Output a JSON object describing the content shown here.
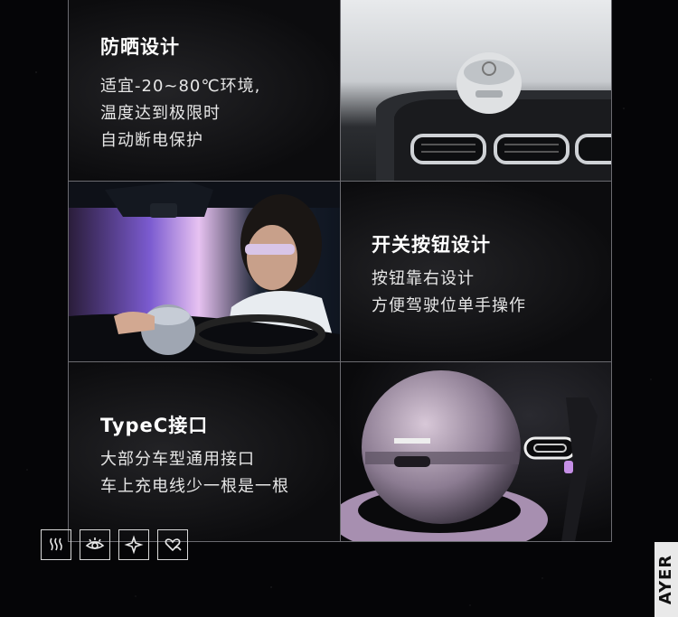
{
  "features": [
    {
      "title": "防晒设计",
      "lines": [
        "适宜-20~80℃环境,",
        "温度达到极限时",
        "自动断电保护"
      ]
    },
    {
      "title": "开关按钮设计",
      "lines": [
        "按钮靠右设计",
        "方便驾驶位单手操作"
      ]
    },
    {
      "title": "TypeC接口",
      "lines": [
        "大部分车型通用接口",
        "车上充电线少一根是一根"
      ]
    }
  ],
  "icons": [
    "heat-waves-icon",
    "eye-icon",
    "sparkle-icon",
    "heart-hand-icon"
  ],
  "brand_text": "AYER"
}
